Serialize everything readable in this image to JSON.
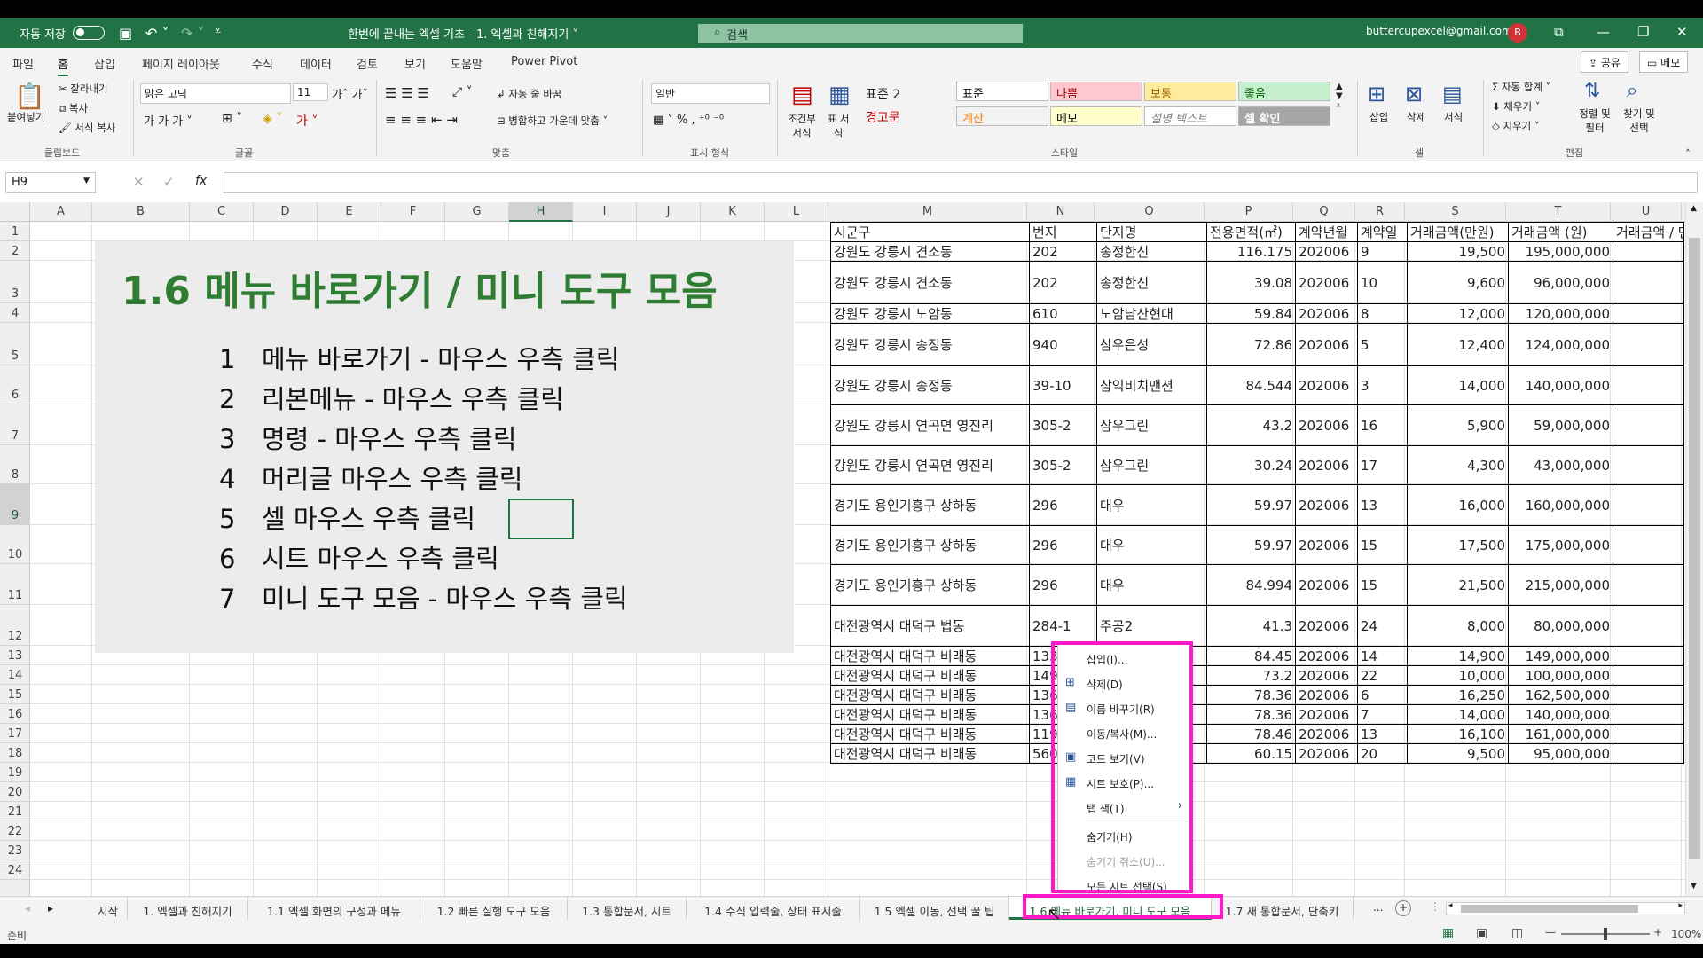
{
  "titlebar": {
    "autosave_label": "자동 저장",
    "toggle_state": "끔",
    "doc_title": "한번에 끝내는 엑셀 기초 - 1. 엑셀과 친해지기 ˅",
    "search_placeholder": "검색",
    "account": "buttercupexcel@gmail.com",
    "avatar_letter": "B"
  },
  "ribbon_tabs": [
    "파일",
    "홈",
    "삽입",
    "페이지 레이아웃",
    "수식",
    "데이터",
    "검토",
    "보기",
    "도움말",
    "Power Pivot"
  ],
  "top_buttons": {
    "share": "공유",
    "memo": "메모"
  },
  "ribbon": {
    "clipboard": {
      "paste": "붙여넣기",
      "cut": "잘라내기",
      "copy": "복사",
      "format_painter": "서식 복사",
      "label": "클립보드"
    },
    "font": {
      "name": "맑은 고딕",
      "size": "11",
      "label": "글꼴"
    },
    "alignment": {
      "wrap": "자동 줄 바꿈",
      "merge": "병합하고 가운데 맞춤",
      "label": "맞춤"
    },
    "number": {
      "format": "일반",
      "label": "표시 형식"
    },
    "styles": {
      "conditional": "조건부 서식",
      "table": "표 서식",
      "left_styles": [
        "표준 2",
        "경고문"
      ],
      "cells": [
        {
          "label": "표준",
          "bg": "#ffffff",
          "fg": "#000000"
        },
        {
          "label": "나쁨",
          "bg": "#ffc7ce",
          "fg": "#9c0006"
        },
        {
          "label": "보통",
          "bg": "#ffeb9c",
          "fg": "#9c6500"
        },
        {
          "label": "좋음",
          "bg": "#c6efce",
          "fg": "#006100"
        },
        {
          "label": "계산",
          "bg": "#f2f2f2",
          "fg": "#fa7d00"
        },
        {
          "label": "메모",
          "bg": "#ffffcc",
          "fg": "#000000"
        },
        {
          "label": "설명 텍스트",
          "bg": "#ffffff",
          "fg": "#7f7f7f"
        },
        {
          "label": "셀 확인",
          "bg": "#a5a5a5",
          "fg": "#ffffff"
        }
      ],
      "label": "스타일"
    },
    "cells": {
      "insert": "삽입",
      "delete": "삭제",
      "format": "서식",
      "label": "셀"
    },
    "editing": {
      "autosum": "자동 합계",
      "fill": "채우기",
      "clear": "지우기",
      "sort": "정렬 및 필터",
      "find": "찾기 및 선택",
      "label": "편집"
    }
  },
  "formula_bar": {
    "namebox": "H9",
    "fx": "fx",
    "formula": ""
  },
  "columns": [
    "A",
    "B",
    "C",
    "D",
    "E",
    "F",
    "G",
    "H",
    "I",
    "J",
    "K",
    "L",
    "M",
    "N",
    "O",
    "P",
    "Q",
    "R",
    "S",
    "T",
    "U"
  ],
  "selected_column": "H",
  "rows": [
    "1",
    "2",
    "3",
    "4",
    "5",
    "6",
    "7",
    "8",
    "9",
    "10",
    "11",
    "12",
    "13",
    "14",
    "15",
    "16",
    "17",
    "18",
    "19",
    "20",
    "21",
    "22",
    "23",
    "24"
  ],
  "selected_row": "9",
  "note": {
    "title": "1.6 메뉴 바로가기 / 미니 도구 모음",
    "items": [
      {
        "num": "1",
        "text": "메뉴 바로가기  - 마우스 우측 클릭"
      },
      {
        "num": "2",
        "text": "리본메뉴 - 마우스 우측 클릭"
      },
      {
        "num": "3",
        "text": "명령 - 마우스 우측 클릭"
      },
      {
        "num": "4",
        "text": "머리글 마우스 우측 클릭"
      },
      {
        "num": "5",
        "text": "셀 마우스 우측 클릭"
      },
      {
        "num": "6",
        "text": "시트 마우스 우측 클릭"
      },
      {
        "num": "7",
        "text": "미니 도구 모음 - 마우스 우측 클릭"
      }
    ]
  },
  "table": {
    "headers": [
      "시군구",
      "번지",
      "단지명",
      "전용면적(㎡)",
      "계약년월",
      "계약일",
      "거래금액(만원)",
      "거래금액 (원)",
      "거래금액 / 면"
    ],
    "rows": [
      [
        "강원도 강릉시 견소동",
        "202",
        "송정한신",
        "116.175",
        "202006",
        "9",
        "19,500",
        "195,000,000",
        ""
      ],
      [
        "강원도 강릉시 견소동",
        "202",
        "송정한신",
        "39.08",
        "202006",
        "10",
        "9,600",
        "96,000,000",
        ""
      ],
      [
        "강원도 강릉시 노암동",
        "610",
        "노암남산현대",
        "59.84",
        "202006",
        "8",
        "12,000",
        "120,000,000",
        ""
      ],
      [
        "강원도 강릉시 송정동",
        "940",
        "삼우은성",
        "72.86",
        "202006",
        "5",
        "12,400",
        "124,000,000",
        ""
      ],
      [
        "강원도 강릉시 송정동",
        "39-10",
        "삼익비치맨션",
        "84.544",
        "202006",
        "3",
        "14,000",
        "140,000,000",
        ""
      ],
      [
        "강원도 강릉시 연곡면 영진리",
        "305-2",
        "삼우그린",
        "43.2",
        "202006",
        "16",
        "5,900",
        "59,000,000",
        ""
      ],
      [
        "강원도 강릉시 연곡면 영진리",
        "305-2",
        "삼우그린",
        "30.24",
        "202006",
        "17",
        "4,300",
        "43,000,000",
        ""
      ],
      [
        "경기도 용인기흥구 상하동",
        "296",
        "대우",
        "59.97",
        "202006",
        "13",
        "16,000",
        "160,000,000",
        ""
      ],
      [
        "경기도 용인기흥구 상하동",
        "296",
        "대우",
        "59.97",
        "202006",
        "15",
        "17,500",
        "175,000,000",
        ""
      ],
      [
        "경기도 용인기흥구 상하동",
        "296",
        "대우",
        "84.994",
        "202006",
        "15",
        "21,500",
        "215,000,000",
        ""
      ],
      [
        "대전광역시 대덕구 법동",
        "284-1",
        "주공2",
        "41.3",
        "202006",
        "24",
        "8,000",
        "80,000,000",
        ""
      ],
      [
        "대전광역시 대덕구 비래동",
        "133",
        "",
        "84.45",
        "202006",
        "14",
        "14,900",
        "149,000,000",
        ""
      ],
      [
        "대전광역시 대덕구 비래동",
        "149",
        "",
        "73.2",
        "202006",
        "22",
        "10,000",
        "100,000,000",
        ""
      ],
      [
        "대전광역시 대덕구 비래동",
        "136",
        "",
        "78.36",
        "202006",
        "6",
        "16,250",
        "162,500,000",
        ""
      ],
      [
        "대전광역시 대덕구 비래동",
        "136",
        "",
        "78.36",
        "202006",
        "7",
        "14,000",
        "140,000,000",
        ""
      ],
      [
        "대전광역시 대덕구 비래동",
        "119",
        "",
        "78.46",
        "202006",
        "13",
        "16,100",
        "161,000,000",
        ""
      ],
      [
        "대전광역시 대덕구 비래동",
        "560",
        "",
        "60.15",
        "202006",
        "20",
        "9,500",
        "95,000,000",
        ""
      ]
    ]
  },
  "context_menu": [
    {
      "label": "삽입(I)...",
      "icon": "",
      "disabled": false
    },
    {
      "label": "삭제(D)",
      "icon": "delete-sheet-icon",
      "disabled": false
    },
    {
      "label": "이름 바꾸기(R)",
      "icon": "rename-icon",
      "disabled": false
    },
    {
      "label": "이동/복사(M)...",
      "icon": "",
      "disabled": false
    },
    {
      "label": "코드 보기(V)",
      "icon": "view-code-icon",
      "disabled": false
    },
    {
      "label": "시트 보호(P)...",
      "icon": "protect-sheet-icon",
      "disabled": false
    },
    {
      "label": "탭 색(T)",
      "icon": "",
      "disabled": false,
      "submenu": true
    },
    {
      "label": "숨기기(H)",
      "icon": "",
      "disabled": false
    },
    {
      "label": "숨기기 취소(U)...",
      "icon": "",
      "disabled": true
    },
    {
      "label": "모든 시트 선택(S)",
      "icon": "",
      "disabled": false
    }
  ],
  "sheet_tabs": [
    {
      "label": "시작",
      "active": false
    },
    {
      "label": "1. 엑셀과 친해지기",
      "active": false
    },
    {
      "label": "1.1 엑셀 화면의 구성과 메뉴",
      "active": false
    },
    {
      "label": "1.2 빠른 실행 도구 모음",
      "active": false
    },
    {
      "label": "1.3 통합문서, 시트",
      "active": false
    },
    {
      "label": "1.4 수식 입력줄, 상태 표시줄",
      "active": false
    },
    {
      "label": "1.5 엑셀 이동, 선택 꿀 팁",
      "active": false
    },
    {
      "label": "1.6 메뉴 바로가기, 미니 도구 모음",
      "active": true
    },
    {
      "label": "1.7 새 통합문서, 단축키",
      "active": false
    }
  ],
  "sheet_ellipsis": "...",
  "status": {
    "ready": "준비",
    "zoom": "100%"
  },
  "accent_color": "#217346",
  "highlight_color": "#ff17c9"
}
